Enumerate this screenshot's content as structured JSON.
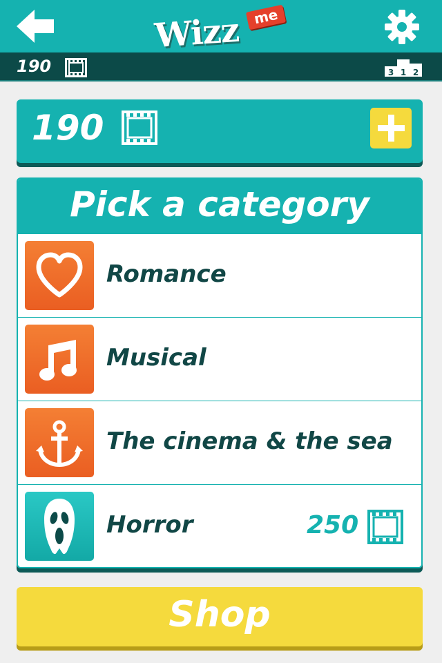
{
  "header": {
    "logo_text": "Wizz",
    "logo_badge": "me",
    "back_icon": "back-arrow-icon",
    "settings_icon": "gear-icon"
  },
  "status_bar": {
    "film_count": "190",
    "film_icon": "film-icon",
    "leaderboard_icon": "podium-icon",
    "podium_digits": [
      "3",
      "1",
      "2"
    ]
  },
  "balance": {
    "film_count": "190",
    "film_icon": "film-icon",
    "add_icon": "plus-icon"
  },
  "categories": {
    "title": "Pick a category",
    "items": [
      {
        "label": "Romance",
        "icon": "heart-icon",
        "tile_color": "#ef6b2a",
        "price": ""
      },
      {
        "label": "Musical",
        "icon": "music-note-icon",
        "tile_color": "#ef6b2a",
        "price": ""
      },
      {
        "label": "The cinema & the sea",
        "icon": "anchor-icon",
        "tile_color": "#ef6b2a",
        "price": ""
      },
      {
        "label": "Horror",
        "icon": "scream-mask-icon",
        "tile_color": "#15b2b0",
        "price": "250"
      }
    ]
  },
  "shop": {
    "label": "Shop"
  },
  "colors": {
    "teal": "#15b2b0",
    "dark_teal": "#0c4a48",
    "orange": "#ef6b2a",
    "yellow": "#f5da3d",
    "label_text": "#114746"
  }
}
